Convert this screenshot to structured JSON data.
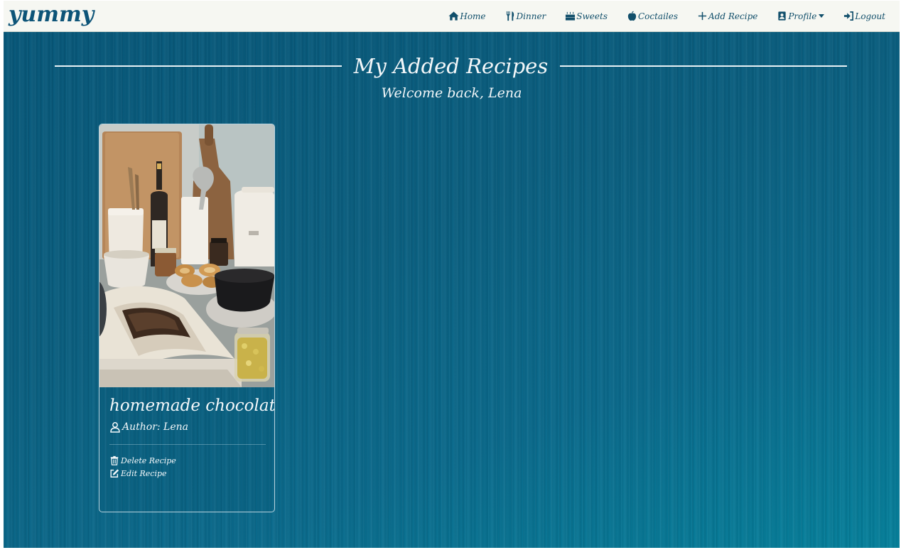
{
  "brand": "yummy",
  "nav": {
    "home": "Home",
    "dinner": "Dinner",
    "sweets": "Sweets",
    "cocktails": "Coctailes",
    "add_recipe": "Add Recipe",
    "profile": "Profile",
    "logout": "Logout"
  },
  "page": {
    "title": "My Added Recipes",
    "welcome": "Welcome back, Lena"
  },
  "recipes": [
    {
      "title": "homemade chocolate",
      "author": "Author: Lena",
      "delete_label": "Delete Recipe",
      "edit_label": "Edit Recipe"
    }
  ],
  "colors": {
    "brand": "#0d5478",
    "navbar_bg": "#f6f7f2",
    "background": "#0a6385",
    "text_light": "#f3f7f9"
  },
  "icons": {
    "home": "house-icon",
    "dinner": "utensils-icon",
    "sweets": "cake-icon",
    "cocktails": "apple-icon",
    "add_recipe": "plus-icon",
    "profile": "contact-card-icon",
    "logout": "sign-in-arrow-icon",
    "author": "user-icon",
    "delete": "trash-icon",
    "edit": "edit-icon"
  }
}
